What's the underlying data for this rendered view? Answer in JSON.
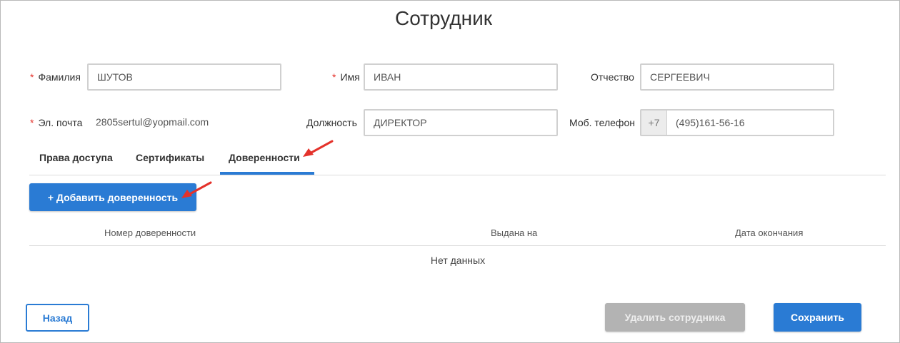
{
  "page": {
    "title": "Сотрудник"
  },
  "form": {
    "surname": {
      "label": "Фамилия",
      "required_mark": "*",
      "value": "ШУТОВ"
    },
    "name": {
      "label": "Имя",
      "required_mark": "*",
      "value": "ИВАН"
    },
    "patronymic": {
      "label": "Отчество",
      "value": "СЕРГЕЕВИЧ"
    },
    "email": {
      "label": "Эл. почта",
      "required_mark": "*",
      "value": "2805sertul@yopmail.com"
    },
    "position": {
      "label": "Должность",
      "value": "ДИРЕКТОР"
    },
    "mobile": {
      "label": "Моб. телефон",
      "prefix": "+7",
      "value": "(495)161-56-16"
    }
  },
  "tabs": [
    {
      "label": "Права доступа",
      "active": false
    },
    {
      "label": "Сертификаты",
      "active": false
    },
    {
      "label": "Доверенности",
      "active": true
    }
  ],
  "accent_color": "#2a7bd4",
  "powers": {
    "add_button": "+ Добавить доверенность",
    "columns": [
      "Номер доверенности",
      "Выдана на",
      "Дата окончания"
    ],
    "empty_text": "Нет данных"
  },
  "footer": {
    "back_label": "Назад",
    "delete_label": "Удалить сотрудника",
    "save_label": "Сохранить"
  },
  "annotations": {
    "arrow_color": "#e4322b",
    "arrow_icon": "red-arrow-icon"
  }
}
